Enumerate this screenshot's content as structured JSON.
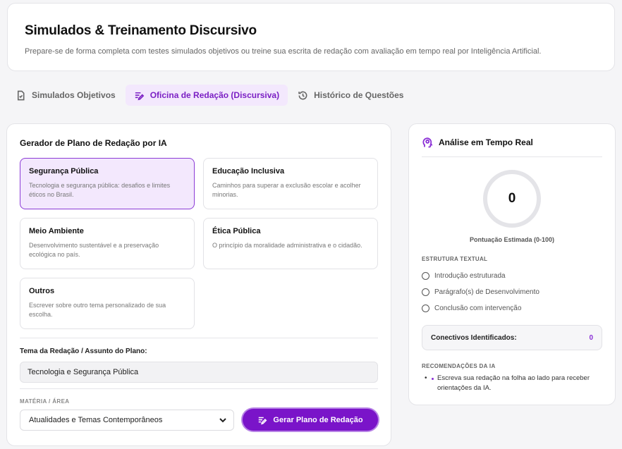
{
  "header": {
    "title": "Simulados & Treinamento Discursivo",
    "subtitle": "Prepare-se de forma completa com testes simulados objetivos ou treine sua escrita de redação com avaliação em tempo real por Inteligência Artificial."
  },
  "tabs": [
    {
      "label": "Simulados Objetivos",
      "icon": "file-check-icon",
      "active": false
    },
    {
      "label": "Oficina de Redação (Discursiva)",
      "icon": "edit-lines-icon",
      "active": true
    },
    {
      "label": "Histórico de Questões",
      "icon": "history-icon",
      "active": false
    }
  ],
  "generator": {
    "title": "Gerador de Plano de Redação por IA",
    "topics": [
      {
        "name": "Segurança Pública",
        "description": "Tecnologia e segurança pública: desafios e limites éticos no Brasil.",
        "selected": true
      },
      {
        "name": "Educação Inclusiva",
        "description": "Caminhos para superar a exclusão escolar e acolher minorias.",
        "selected": false
      },
      {
        "name": "Meio Ambiente",
        "description": "Desenvolvimento sustentável e a preservação ecológica no país.",
        "selected": false
      },
      {
        "name": "Ética Pública",
        "description": "O princípio da moralidade administrativa e o cidadão.",
        "selected": false
      },
      {
        "name": "Outros",
        "description": "Escrever sobre outro tema personalizado de sua escolha.",
        "selected": false
      }
    ],
    "theme_label": "Tema da Redação / Assunto do Plano:",
    "theme_value": "Tecnologia e Segurança Pública",
    "subject_label": "MATÉRIA / ÁREA",
    "subject_value": "Atualidades e Temas Contemporâneos",
    "generate_label": "Gerar Plano de Redação"
  },
  "analysis": {
    "title": "Análise em Tempo Real",
    "score": "0",
    "score_caption": "Pontuação Estimada (0-100)",
    "structure_title": "ESTRUTURA TEXTUAL",
    "structure_items": [
      "Introdução estruturada",
      "Parágrafo(s) de Desenvolvimento",
      "Conclusão com intervenção"
    ],
    "connectives_label": "Conectivos Identificados:",
    "connectives_value": "0",
    "recommendations_title": "RECOMENDAÇÕES DA IA",
    "recommendations": [
      "Escreva sua redação na folha ao lado para receber orientações da IA."
    ]
  },
  "colors": {
    "accent": "#7a14c9",
    "accent_light": "#f3e8fd"
  }
}
